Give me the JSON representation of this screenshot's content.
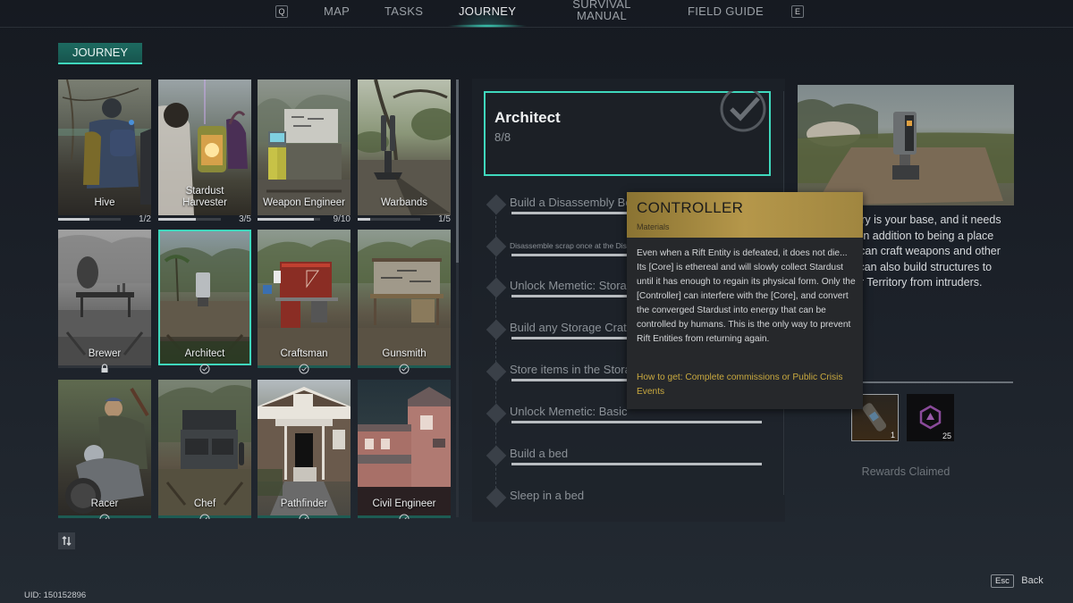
{
  "nav": {
    "prev_key": "Q",
    "next_key": "E",
    "tabs": [
      {
        "label": "MAP",
        "active": false
      },
      {
        "label": "TASKS",
        "active": false
      },
      {
        "label": "JOURNEY",
        "active": true
      },
      {
        "label": "SURVIVAL MANUAL",
        "line1": "SURVIVAL",
        "line2": "MANUAL",
        "active": false
      },
      {
        "label": "FIELD GUIDE",
        "active": false
      }
    ]
  },
  "section_title": "JOURNEY",
  "journeys": [
    {
      "name": "Hive",
      "progress": "1/2",
      "fraction": 0.5,
      "state": "in-progress"
    },
    {
      "name": "Stardust Harvester",
      "line1": "Stardust",
      "line2": "Harvester",
      "progress": "3/5",
      "fraction": 0.6,
      "state": "in-progress"
    },
    {
      "name": "Weapon Engineer",
      "progress": "9/10",
      "fraction": 0.9,
      "state": "in-progress"
    },
    {
      "name": "Warbands",
      "progress": "1/5",
      "fraction": 0.2,
      "state": "in-progress"
    },
    {
      "name": "Brewer",
      "state": "locked"
    },
    {
      "name": "Architect",
      "state": "completed",
      "selected": true
    },
    {
      "name": "Craftsman",
      "state": "completed"
    },
    {
      "name": "Gunsmith",
      "state": "completed"
    },
    {
      "name": "Racer",
      "state": "completed"
    },
    {
      "name": "Chef",
      "state": "completed"
    },
    {
      "name": "Pathfinder",
      "state": "completed"
    },
    {
      "name": "Civil Engineer",
      "state": "completed"
    }
  ],
  "detail": {
    "title": "Architect",
    "progress": "8/8",
    "tasks": [
      {
        "label": "Build a Disassembly Bench",
        "small": false
      },
      {
        "label": "Disassemble scrap once at the Disassembly Bench",
        "small": true
      },
      {
        "label": "Unlock Memetic: Storage",
        "small": false
      },
      {
        "label": "Build any Storage Crate",
        "small": false
      },
      {
        "label": "Store items in the Storage Crate",
        "small": false
      },
      {
        "label": "Unlock Memetic: Basic",
        "small": false
      },
      {
        "label": "Build a bed",
        "small": false
      },
      {
        "label": "Sleep in a bed",
        "small": false
      }
    ]
  },
  "description": "Your Territory is your base, and it needs protecting. In addition to being a place where you can craft weapons and other items, you can also build structures to defend your Territory from intruders.",
  "rewards": {
    "items": [
      {
        "icon": "controller-item-icon",
        "quantity": "1"
      },
      {
        "icon": "stardust-token-icon",
        "quantity": "25"
      }
    ],
    "status": "Rewards Claimed"
  },
  "tooltip": {
    "name": "CONTROLLER",
    "category": "Materials",
    "body": "Even when a Rift Entity is defeated, it does not die... Its [Core] is ethereal and will slowly collect Stardust until it has enough to regain its physical form. Only the [Controller] can interfere with the [Core], and convert the converged Stardust into energy that can be controlled by humans. This is the only way to prevent Rift Entities from returning again.",
    "how_to_get": "How to get: Complete commissions or Public Crisis Events"
  },
  "sort_icon": "sort-icon",
  "uid": "UID: 150152896",
  "back": {
    "key": "Esc",
    "label": "Back"
  },
  "colors": {
    "accent": "#3fd8bd",
    "tooltip_gold": "#b5974a",
    "how_to_get": "#c9a93f"
  }
}
